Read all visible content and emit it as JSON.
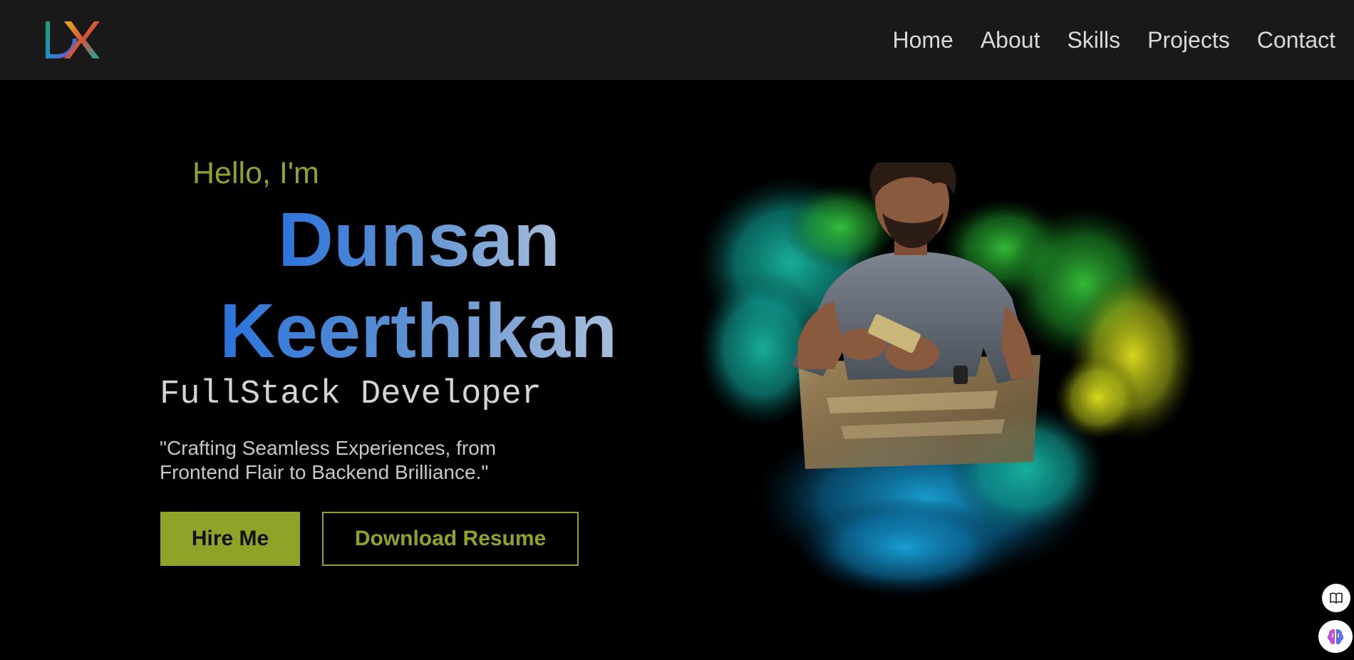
{
  "header": {
    "logo_icon": "dk-monogram-logo",
    "nav": [
      {
        "label": "Home"
      },
      {
        "label": "About"
      },
      {
        "label": "Skills"
      },
      {
        "label": "Projects"
      },
      {
        "label": "Contact"
      }
    ]
  },
  "hero": {
    "greeting": "Hello, I'm",
    "first_name": "Dunsan",
    "last_name": "Keerthikan",
    "role": "FullStack Developer",
    "tagline": "\"Crafting Seamless Experiences, from Frontend Flair to Backend Brilliance.\"",
    "buttons": {
      "hire": "Hire Me",
      "resume": "Download Resume"
    },
    "image_icon": "profile-photo-with-colored-smoke"
  },
  "widgets": {
    "book_icon": "book-open-icon",
    "brain_icon": "brain-icon"
  },
  "colors": {
    "background": "#000000",
    "header_bg": "#1a191a",
    "accent_olive": "#8fa328",
    "name_gradient_start": "#2b74dd",
    "name_gradient_end": "#a7bedc",
    "nav_text": "#d9d9d9"
  }
}
